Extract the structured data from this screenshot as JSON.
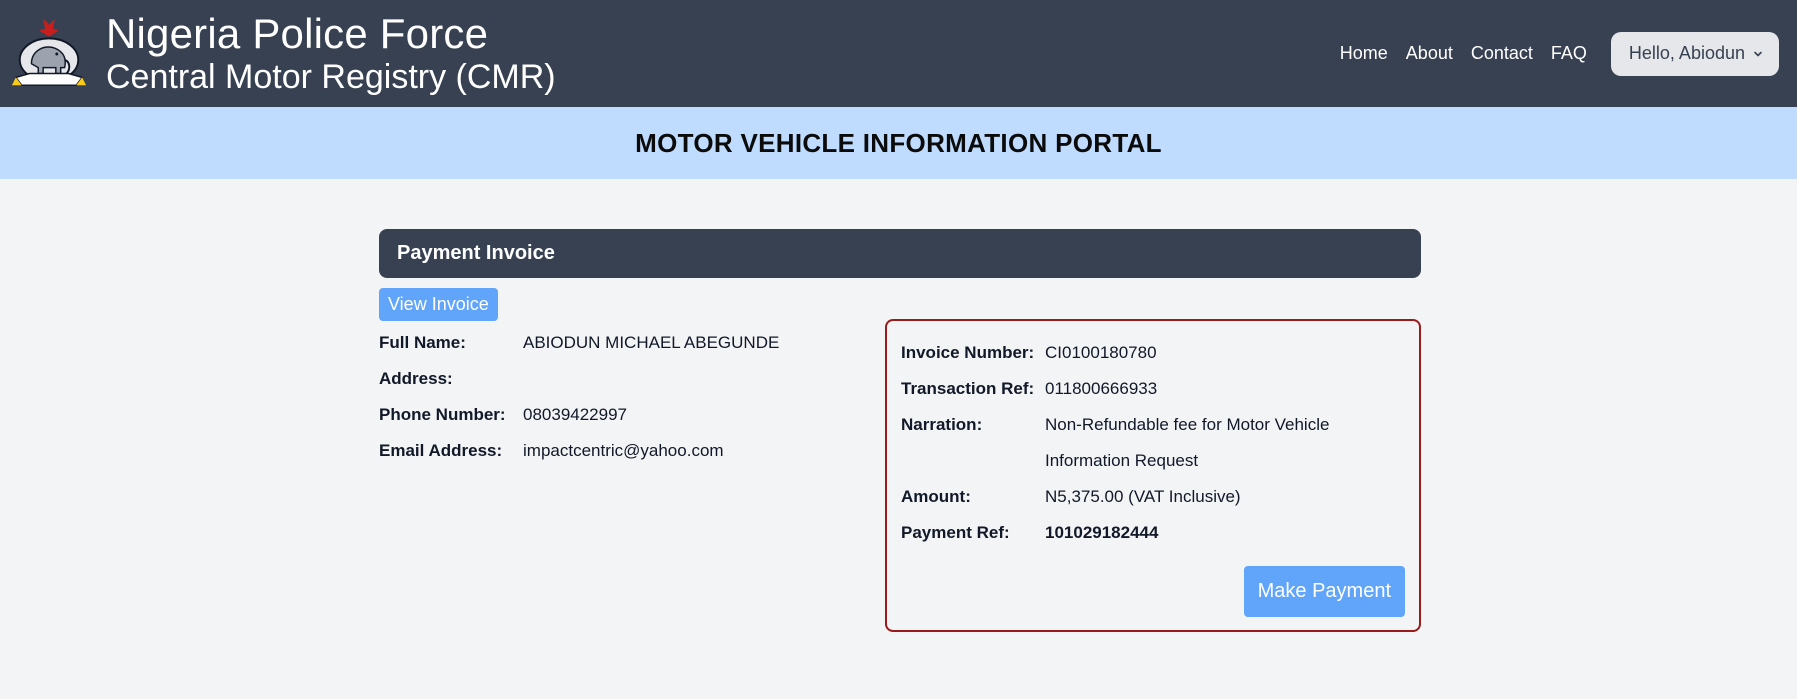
{
  "header": {
    "title": "Nigeria Police Force",
    "subtitle": "Central Motor Registry (CMR)",
    "logo_icon": "police-crest-icon",
    "nav": [
      {
        "label": "Home"
      },
      {
        "label": "About"
      },
      {
        "label": "Contact"
      },
      {
        "label": "FAQ"
      }
    ],
    "user_menu_label": "Hello, Abiodun"
  },
  "banner": {
    "title": "MOTOR VEHICLE INFORMATION PORTAL"
  },
  "invoice_section": {
    "header": "Payment Invoice",
    "view_invoice_label": "View Invoice",
    "customer": {
      "full_name_label": "Full Name:",
      "full_name": "ABIODUN MICHAEL ABEGUNDE",
      "address_label": "Address:",
      "address": "",
      "phone_label": "Phone Number:",
      "phone": "08039422997",
      "email_label": "Email Address:",
      "email": "impactcentric@yahoo.com"
    },
    "invoice": {
      "invoice_number_label": "Invoice Number:",
      "invoice_number": "CI0100180780",
      "transaction_ref_label": "Transaction Ref:",
      "transaction_ref": "011800666933",
      "narration_label": "Narration:",
      "narration": "Non-Refundable fee for Motor Vehicle Information Request",
      "amount_label": "Amount:",
      "amount": "N5,375.00 (VAT Inclusive)",
      "payment_ref_label": "Payment Ref:",
      "payment_ref": "101029182444",
      "make_payment_label": "Make Payment"
    }
  },
  "colors": {
    "header_bg": "#374151",
    "banner_bg": "#bfdbfe",
    "page_bg": "#f3f4f6",
    "button_bg": "#60a5fa",
    "invoice_border": "#991b1b"
  }
}
